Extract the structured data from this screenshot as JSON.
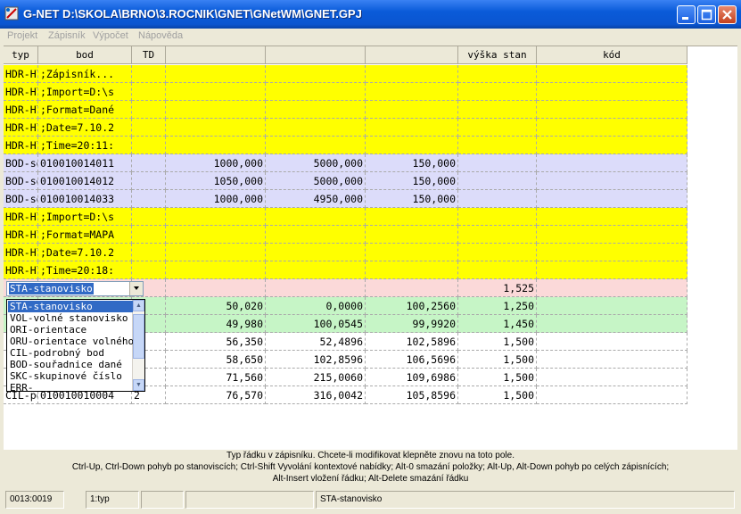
{
  "window": {
    "title": "G-NET  D:\\SKOLA\\BRNO\\3.ROCNIK\\GNET\\GNetWM\\GNET.GPJ"
  },
  "menu": [
    "Projekt",
    "Zápisník",
    "Výpočet",
    "Nápověda"
  ],
  "table": {
    "columns": [
      "typ",
      "bod",
      "TD",
      "",
      "",
      "",
      "výška stan",
      "kód"
    ],
    "rows": [
      {
        "style": "yellow",
        "cells": [
          "HDR-Hlavička",
          ";Zápisník...",
          "",
          "",
          "",
          "",
          "",
          ""
        ]
      },
      {
        "style": "yellow",
        "cells": [
          "HDR-Hlavička",
          ";Import=D:\\s",
          "",
          "",
          "",
          "",
          "",
          ""
        ]
      },
      {
        "style": "yellow",
        "cells": [
          "HDR-Hlavička",
          ";Format=Dané",
          "",
          "",
          "",
          "",
          "",
          ""
        ]
      },
      {
        "style": "yellow",
        "cells": [
          "HDR-Hlavička",
          ";Date=7.10.2",
          "",
          "",
          "",
          "",
          "",
          ""
        ]
      },
      {
        "style": "yellow",
        "cells": [
          "HDR-Hlavička",
          ";Time=20:11:",
          "",
          "",
          "",
          "",
          "",
          ""
        ]
      },
      {
        "style": "lav",
        "cells": [
          "BOD-souřadnice",
          "010010014011",
          "",
          "1000,000",
          "5000,000",
          "150,000",
          "",
          ""
        ]
      },
      {
        "style": "lav",
        "cells": [
          "BOD-souřadnice",
          "010010014012",
          "",
          "1050,000",
          "5000,000",
          "150,000",
          "",
          ""
        ]
      },
      {
        "style": "lav",
        "cells": [
          "BOD-souřadnice",
          "010010014033",
          "",
          "1000,000",
          "4950,000",
          "150,000",
          "",
          ""
        ]
      },
      {
        "style": "yellow",
        "cells": [
          "HDR-Hlavička",
          ";Import=D:\\s",
          "",
          "",
          "",
          "",
          "",
          ""
        ]
      },
      {
        "style": "yellow",
        "cells": [
          "HDR-Hlavička",
          ";Format=MAPA",
          "",
          "",
          "",
          "",
          "",
          ""
        ]
      },
      {
        "style": "yellow",
        "cells": [
          "HDR-Hlavička",
          ";Date=7.10.2",
          "",
          "",
          "",
          "",
          "",
          ""
        ]
      },
      {
        "style": "yellow",
        "cells": [
          "HDR-Hlavička",
          ";Time=20:18:",
          "",
          "",
          "",
          "",
          "",
          ""
        ]
      },
      {
        "style": "pink",
        "cells": [
          "",
          "",
          "",
          "",
          "",
          "",
          "1,525",
          ""
        ]
      },
      {
        "style": "green",
        "cells": [
          "",
          "",
          "",
          "50,020",
          "0,0000",
          "100,2560",
          "1,250",
          ""
        ]
      },
      {
        "style": "green",
        "cells": [
          "",
          "",
          "",
          "49,980",
          "100,0545",
          "99,9920",
          "1,450",
          ""
        ]
      },
      {
        "style": "white",
        "cells": [
          "",
          "",
          "",
          "56,350",
          "52,4896",
          "102,5896",
          "1,500",
          ""
        ]
      },
      {
        "style": "white",
        "cells": [
          "",
          "",
          "",
          "58,650",
          "102,8596",
          "106,5696",
          "1,500",
          ""
        ]
      },
      {
        "style": "white",
        "cells": [
          "",
          "",
          "",
          "71,560",
          "215,0060",
          "109,6986",
          "1,500",
          ""
        ]
      },
      {
        "style": "white",
        "cells": [
          "CIL-podrobný bod",
          "010010010004",
          "2",
          "76,570",
          "316,0042",
          "105,8596",
          "1,500",
          ""
        ]
      }
    ]
  },
  "combo": {
    "value": "STA-stanovisko",
    "options": [
      "STA-stanovisko",
      "VOL-volné stanovisko",
      "ORI-orientace",
      "ORU-orientace volného",
      "CIL-podrobný bod",
      "BOD-souřadnice dané",
      "SKC-skupinové číslo",
      "ERR-"
    ]
  },
  "info": {
    "line1": "Typ řádku v zápisníku. Chcete-li modifikovat klepněte znovu na toto pole.",
    "line2": "Ctrl-Up, Ctrl-Down pohyb po stanoviscích; Ctrl-Shift Vyvolání kontextové nabídky; Alt-0 smazání položky; Alt-Up, Alt-Down pohyb po celých zápisnících;",
    "line3": "Alt-Insert vložení řádku; Alt-Delete smazání řádku"
  },
  "status": {
    "position": "0013:0019",
    "field": "1:typ",
    "p3": "",
    "p4": "",
    "value": "STA-stanovisko"
  },
  "colors": {
    "yellow": "#ffff00",
    "lavender": "#dcdcfa",
    "pink": "#fbd9d9",
    "green": "#c6f5c6",
    "selection": "#316ac5"
  }
}
